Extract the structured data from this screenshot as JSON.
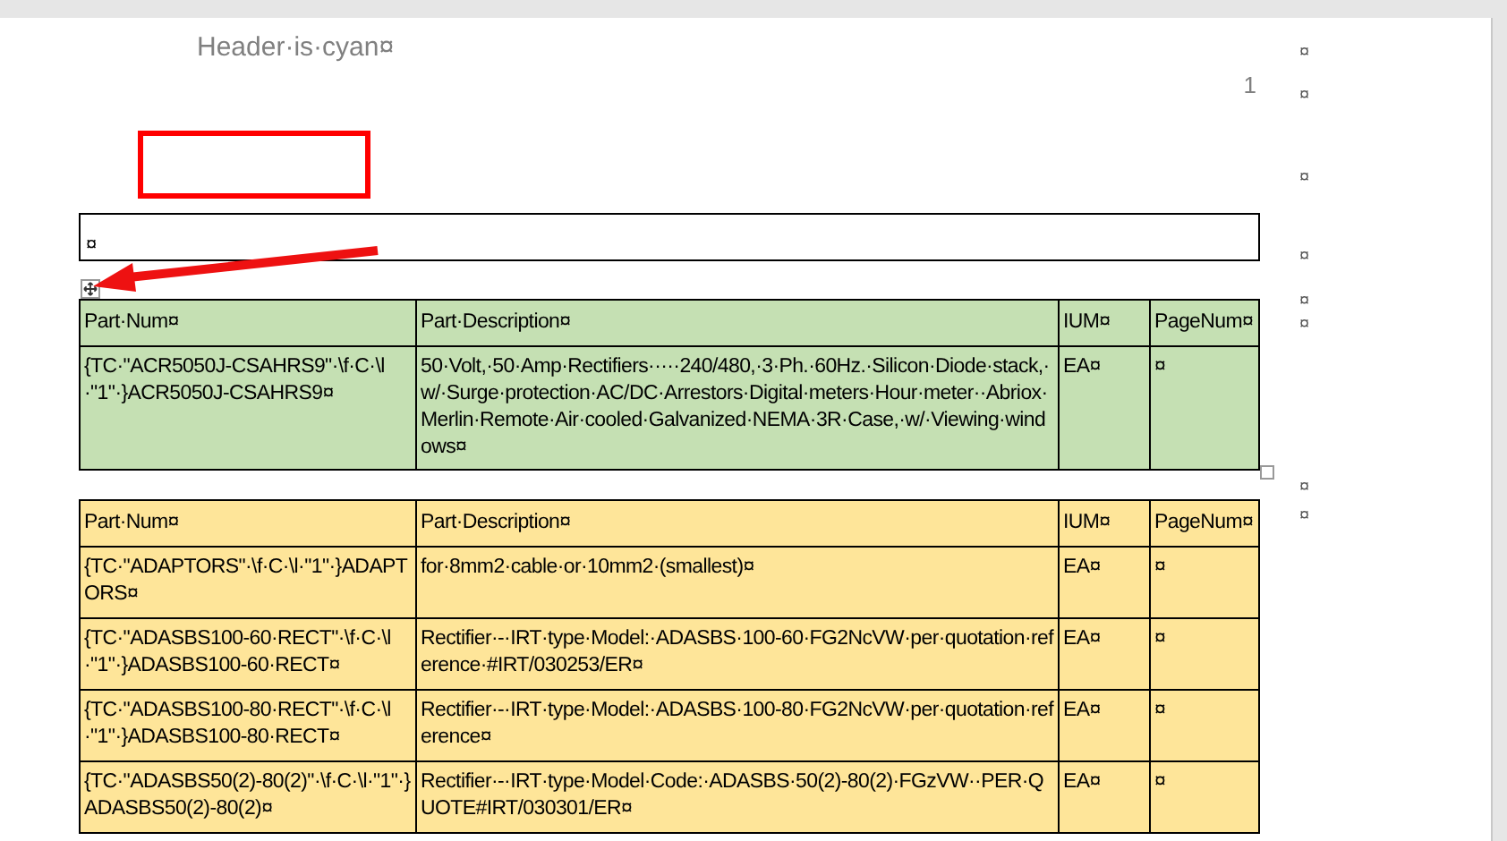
{
  "header": {
    "text": "Header·is·cyan¤"
  },
  "page_number": "1",
  "empty_table": {
    "cell": "¤"
  },
  "tables": [
    {
      "color": "#c5e0b3",
      "columns": [
        "Part·Num¤",
        "Part·Description¤",
        "IUM¤",
        "PageNum¤"
      ],
      "rows": [
        [
          "{TC·\"ACR5050J-CSAHRS9\"·\\f·C·\\l·\"1\"·}ACR5050J-CSAHRS9¤",
          "50·Volt,·50·Amp·Rectifiers·····240/480,·3·Ph.·60Hz.·Silicon·Diode·stack,·w/·Surge·protection·AC/DC·Arrestors·Digital·meters·Hour·meter··Abriox·Merlin·Remote·Air·cooled·Galvanized·NEMA·3R·Case,·w/·Viewing·windows¤",
          "EA¤",
          "¤"
        ]
      ]
    },
    {
      "color": "#fee599",
      "columns": [
        "Part·Num¤",
        "Part·Description¤",
        "IUM¤",
        "PageNum¤"
      ],
      "rows": [
        [
          "{TC·\"ADAPTORS\"·\\f·C·\\l·\"1\"·}ADAPTORS¤",
          "for·8mm2·cable·or·10mm2·(smallest)¤",
          "EA¤",
          "¤"
        ],
        [
          "{TC·\"ADASBS100-60·RECT\"·\\f·C·\\l·\"1\"·}ADASBS100-60·RECT¤",
          "Rectifier·-·IRT·type·Model:·ADASBS·100-60·FG2NcVW·per·quotation·reference·#IRT/030253/ER¤",
          "EA¤",
          "¤"
        ],
        [
          "{TC·\"ADASBS100-80·RECT\"·\\f·C·\\l·\"1\"·}ADASBS100-80·RECT¤",
          "Rectifier·-·IRT·type·Model:·ADASBS·100-80·FG2NcVW·per·quotation·reference¤",
          "EA¤",
          "¤"
        ],
        [
          "{TC·\"ADASBS50(2)-80(2)\"·\\f·C·\\l·\"1\"·}ADASBS50(2)-80(2)¤",
          "Rectifier·-·IRT·type·Model·Code:·ADASBS·50(2)-80(2)·FGzVW··PER·QUOTE#IRT/030301/ER¤",
          "EA¤",
          "¤"
        ]
      ]
    }
  ],
  "margin_marks": [
    "¤",
    "¤",
    "¤",
    "¤",
    "¤",
    "¤",
    "¤",
    "¤"
  ]
}
